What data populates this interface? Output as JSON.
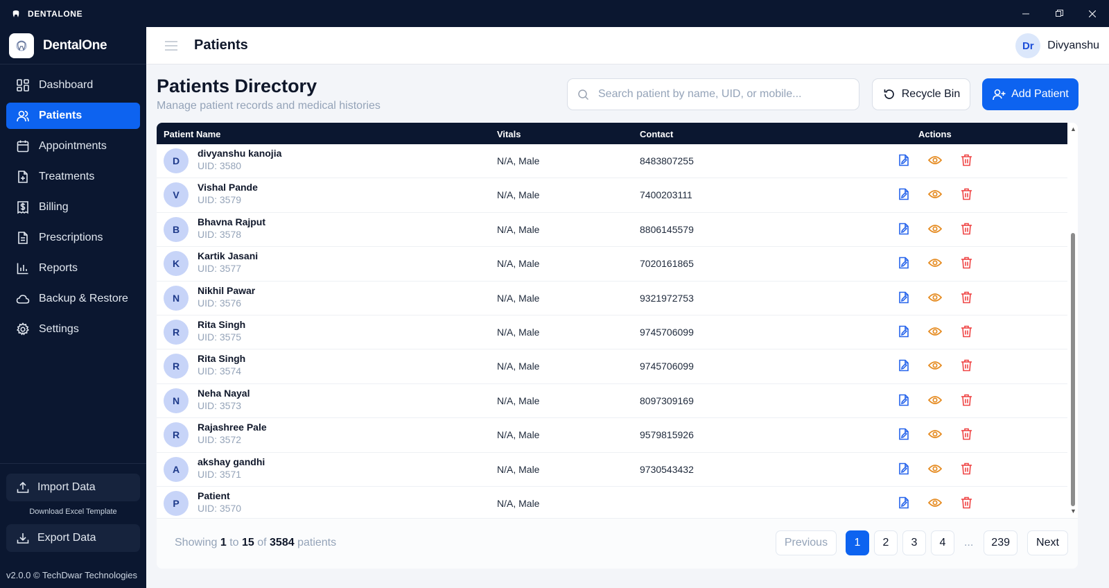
{
  "window": {
    "title": "DENTALONE"
  },
  "brand": {
    "name": "DentalOne"
  },
  "nav": [
    {
      "label": "Dashboard",
      "icon": "dashboard-icon"
    },
    {
      "label": "Patients",
      "icon": "users-icon",
      "active": true
    },
    {
      "label": "Appointments",
      "icon": "calendar-icon"
    },
    {
      "label": "Treatments",
      "icon": "file-plus-icon"
    },
    {
      "label": "Billing",
      "icon": "receipt-dollar-icon"
    },
    {
      "label": "Prescriptions",
      "icon": "document-icon"
    },
    {
      "label": "Reports",
      "icon": "bar-chart-icon"
    },
    {
      "label": "Backup & Restore",
      "icon": "cloud-icon"
    },
    {
      "label": "Settings",
      "icon": "gear-icon"
    }
  ],
  "sidebar_bottom": {
    "import_label": "Import Data",
    "template_link": "Download Excel Template",
    "export_label": "Export Data",
    "version": "v2.0.0 © TechDwar Technologies"
  },
  "header": {
    "title": "Patients",
    "user_initials": "Dr",
    "user_name": "Divyanshu"
  },
  "main": {
    "title": "Patients Directory",
    "subtitle": "Manage patient records and medical histories",
    "search_placeholder": "Search patient by name, UID, or mobile...",
    "recycle_label": "Recycle Bin",
    "add_label": "Add Patient"
  },
  "table": {
    "columns": [
      "Patient Name",
      "Vitals",
      "Contact",
      "Actions"
    ],
    "rows": [
      {
        "initial": "D",
        "name": "divyanshu kanojia",
        "uid": "UID: 3580",
        "vitals": "N/A, Male",
        "contact": "8483807255"
      },
      {
        "initial": "V",
        "name": "Vishal Pande",
        "uid": "UID: 3579",
        "vitals": "N/A, Male",
        "contact": "7400203111"
      },
      {
        "initial": "B",
        "name": "Bhavna Rajput",
        "uid": "UID: 3578",
        "vitals": "N/A, Male",
        "contact": "8806145579"
      },
      {
        "initial": "K",
        "name": "Kartik Jasani",
        "uid": "UID: 3577",
        "vitals": "N/A, Male",
        "contact": "7020161865"
      },
      {
        "initial": "N",
        "name": "Nikhil Pawar",
        "uid": "UID: 3576",
        "vitals": "N/A, Male",
        "contact": "9321972753"
      },
      {
        "initial": "R",
        "name": "Rita Singh",
        "uid": "UID: 3575",
        "vitals": "N/A, Male",
        "contact": "9745706099"
      },
      {
        "initial": "R",
        "name": "Rita Singh",
        "uid": "UID: 3574",
        "vitals": "N/A, Male",
        "contact": "9745706099"
      },
      {
        "initial": "N",
        "name": "Neha Nayal",
        "uid": "UID: 3573",
        "vitals": "N/A, Male",
        "contact": "8097309169"
      },
      {
        "initial": "R",
        "name": "Rajashree Pale",
        "uid": "UID: 3572",
        "vitals": "N/A, Male",
        "contact": "9579815926"
      },
      {
        "initial": "A",
        "name": "akshay gandhi",
        "uid": "UID: 3571",
        "vitals": "N/A, Male",
        "contact": "9730543432"
      },
      {
        "initial": "P",
        "name": "Patient",
        "uid": "UID: 3570",
        "vitals": "N/A, Male",
        "contact": ""
      }
    ]
  },
  "pagination": {
    "showing_prefix": "Showing",
    "from": "1",
    "to_word": "to",
    "to": "15",
    "of_word": "of",
    "total": "3584",
    "suffix": "patients",
    "previous": "Previous",
    "pages": [
      "1",
      "2",
      "3",
      "4"
    ],
    "ellipsis": "...",
    "last_page": "239",
    "next": "Next",
    "current_page": "1"
  },
  "colors": {
    "accent": "#0d63f0",
    "sidebar": "#0b1730",
    "edit": "#2563eb",
    "view": "#e58a1f",
    "delete": "#ef4444"
  }
}
